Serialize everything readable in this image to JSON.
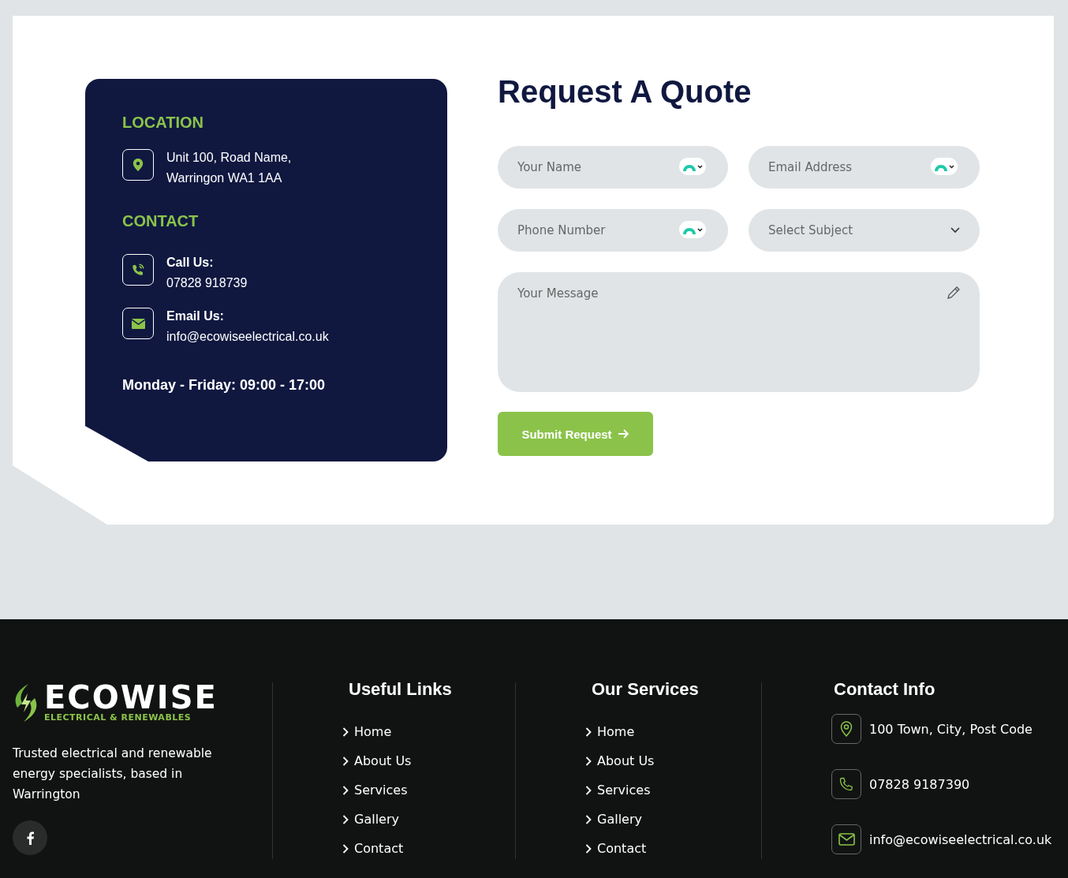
{
  "contact_panel": {
    "location_heading": "LOCATION",
    "address_lines": [
      "Unit 100, Road Name,",
      "Warringon WA1 1AA"
    ],
    "contact_heading": "CONTACT",
    "items": [
      {
        "kind": "phone",
        "label": "Call Us:",
        "value": "07828 918739"
      },
      {
        "kind": "email",
        "label": "Email Us:",
        "value": "info@ecowiseelectrical.co.uk"
      }
    ],
    "hours": "Monday - Friday: 09:00 - 17:00"
  },
  "quote_form": {
    "title": "Request A Quote",
    "fields": [
      {
        "kind": "text",
        "placeholder": "Your Name"
      },
      {
        "kind": "text",
        "placeholder": "Email Address"
      },
      {
        "kind": "text",
        "placeholder": "Phone Number"
      },
      {
        "kind": "select",
        "placeholder": "Select Subject"
      }
    ],
    "message": {
      "placeholder": "Your Message"
    },
    "submit": "Submit Request"
  },
  "footer": {
    "logo": {
      "name": "ECOWISE",
      "tagline": "ELECTRICAL & RENEWABLES"
    },
    "about": "Trusted electrical and renewable energy specialists, based in Warrington",
    "columns": [
      {
        "heading": "Useful Links",
        "links": [
          "Home",
          "About Us",
          "Services",
          "Gallery",
          "Contact"
        ]
      },
      {
        "heading": "Our Services",
        "links": [
          "Home",
          "About Us",
          "Services",
          "Gallery",
          "Contact"
        ]
      }
    ],
    "contact_info": {
      "heading": "Contact Info",
      "items": [
        {
          "kind": "location",
          "text": "100 Town, City, Post Code"
        },
        {
          "kind": "phone",
          "text": "07828 9187390"
        },
        {
          "kind": "email",
          "text": "info@ecowiseelectrical.co.uk"
        }
      ]
    }
  }
}
